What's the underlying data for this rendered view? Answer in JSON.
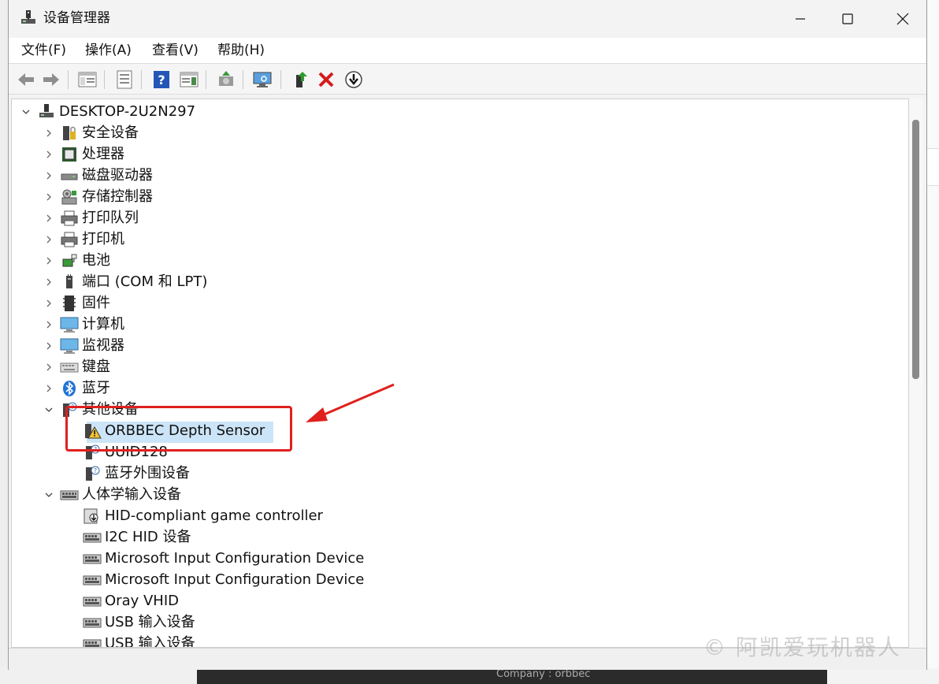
{
  "window": {
    "title": "设备管理器",
    "controls": {
      "minimize": "minimize",
      "maximize": "maximize",
      "close": "close"
    }
  },
  "menu": [
    "文件(F)",
    "操作(A)",
    "查看(V)",
    "帮助(H)"
  ],
  "toolbar": [
    "back-icon",
    "forward-icon",
    "show-hide-console-tree-icon",
    "properties-icon",
    "help-icon",
    "action-pane-icon",
    "update-driver-icon",
    "scan-hardware-icon",
    "enable-device-icon",
    "uninstall-device-icon",
    "disable-device-icon"
  ],
  "tree": {
    "root": "DESKTOP-2U2N297",
    "categories": [
      {
        "label": "安全设备",
        "icon": "security-device-icon"
      },
      {
        "label": "处理器",
        "icon": "processor-icon"
      },
      {
        "label": "磁盘驱动器",
        "icon": "disk-drive-icon"
      },
      {
        "label": "存储控制器",
        "icon": "storage-controller-icon"
      },
      {
        "label": "打印队列",
        "icon": "print-queue-icon"
      },
      {
        "label": "打印机",
        "icon": "printer-icon"
      },
      {
        "label": "电池",
        "icon": "battery-icon"
      },
      {
        "label": "端口 (COM 和 LPT)",
        "icon": "port-icon"
      },
      {
        "label": "固件",
        "icon": "firmware-icon"
      },
      {
        "label": "计算机",
        "icon": "computer-icon"
      },
      {
        "label": "监视器",
        "icon": "monitor-icon"
      },
      {
        "label": "键盘",
        "icon": "keyboard-icon"
      },
      {
        "label": "蓝牙",
        "icon": "bluetooth-icon"
      }
    ],
    "other_devices": {
      "label": "其他设备",
      "children": [
        {
          "label": "ORBBEC Depth Sensor",
          "icon": "warning-device-icon"
        },
        {
          "label": "UUID128",
          "icon": "unknown-device-icon"
        },
        {
          "label": "蓝牙外围设备",
          "icon": "unknown-device-icon"
        }
      ]
    },
    "hid": {
      "label": "人体学输入设备",
      "children": [
        "HID-compliant game controller",
        "I2C HID 设备",
        "Microsoft Input Configuration Device",
        "Microsoft Input Configuration Device",
        "Oray VHID",
        "USB 输入设备",
        "USB 输入设备"
      ]
    }
  },
  "watermark": "© 阿凯爱玩机器人",
  "background_text": "Company : orbbec",
  "colors": {
    "annotation": "#e0201e",
    "selection": "#cce4f7",
    "scrollbar_thumb": "#8a8a8a"
  }
}
